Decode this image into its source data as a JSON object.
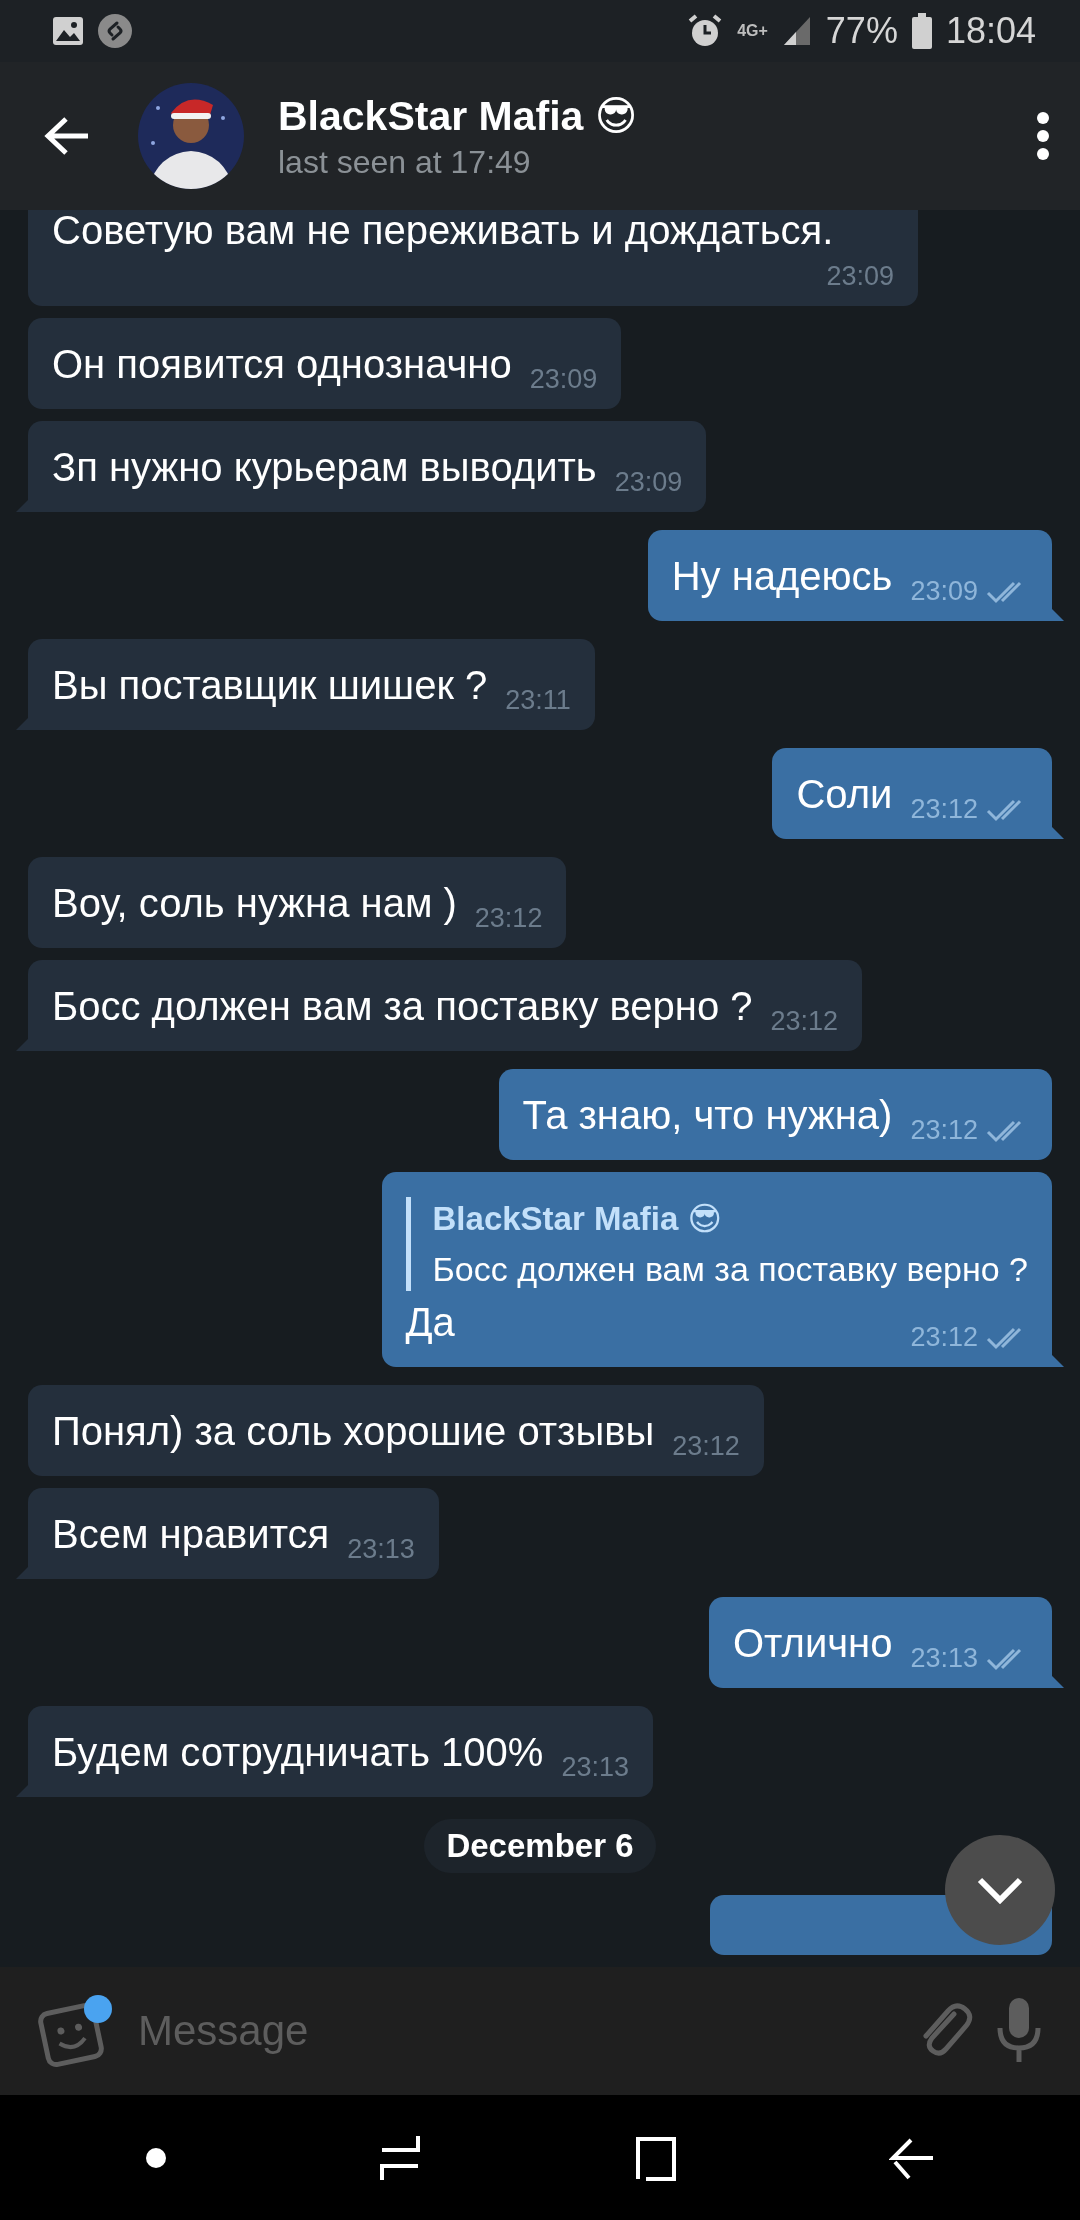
{
  "status_bar": {
    "network": "4G+",
    "battery": "77%",
    "time": "18:04"
  },
  "header": {
    "title": "BlackStar Mafia 😎",
    "subtitle": "last seen at 17:49"
  },
  "messages": [
    {
      "kind": "incoming",
      "text": "Советую вам не переживать и дождаться.",
      "time": "23:09"
    },
    {
      "kind": "incoming",
      "text": "Он появится однозначно",
      "time": "23:09"
    },
    {
      "kind": "incoming",
      "text": "Зп нужно курьерам выводить",
      "time": "23:09"
    },
    {
      "kind": "outgoing",
      "text": "Ну надеюсь",
      "time": "23:09",
      "read": true
    },
    {
      "kind": "incoming",
      "text": "Вы поставщик шишек ?",
      "time": "23:11"
    },
    {
      "kind": "outgoing",
      "text": "Соли",
      "time": "23:12",
      "read": true
    },
    {
      "kind": "incoming",
      "text": "Воу, соль нужна нам )",
      "time": "23:12"
    },
    {
      "kind": "incoming",
      "text": "Босс должен вам за поставку верно ?",
      "time": "23:12"
    },
    {
      "kind": "outgoing",
      "text": "Та знаю, что нужна)",
      "time": "23:12",
      "read": true
    },
    {
      "kind": "outgoing",
      "text": "Да",
      "time": "23:12",
      "read": true,
      "reply": {
        "author": "BlackStar Mafia 😎",
        "text": "Босс должен вам за поставку верно ?"
      }
    },
    {
      "kind": "incoming",
      "text": "Понял) за соль хорошие отзывы",
      "time": "23:12"
    },
    {
      "kind": "incoming",
      "text": "Всем нравится",
      "time": "23:13"
    },
    {
      "kind": "outgoing",
      "text": "Отлично",
      "time": "23:13",
      "read": true
    },
    {
      "kind": "incoming",
      "text": "Будем сотрудничать 100%",
      "time": "23:13"
    }
  ],
  "date_separator": "December 6",
  "composer": {
    "placeholder": "Message"
  }
}
